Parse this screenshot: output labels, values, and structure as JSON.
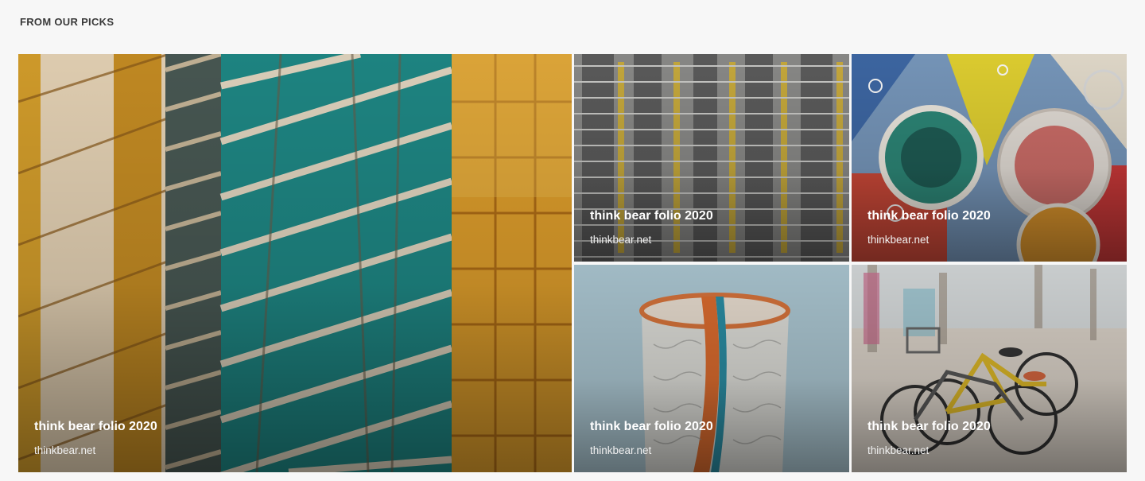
{
  "section": {
    "title": "FROM OUR PICKS"
  },
  "picks": [
    {
      "title": "think bear folio 2020",
      "site": "thinkbear.net",
      "image": "reflective-glass-buildings"
    },
    {
      "title": "think bear folio 2020",
      "site": "thinkbear.net",
      "image": "apartment-tower-facade"
    },
    {
      "title": "think bear folio 2020",
      "site": "thinkbear.net",
      "image": "colorful-oil-bubbles"
    },
    {
      "title": "think bear folio 2020",
      "site": "thinkbear.net",
      "image": "painted-water-tower"
    },
    {
      "title": "think bear folio 2020",
      "site": "thinkbear.net",
      "image": "bicycles-on-beach"
    }
  ]
}
